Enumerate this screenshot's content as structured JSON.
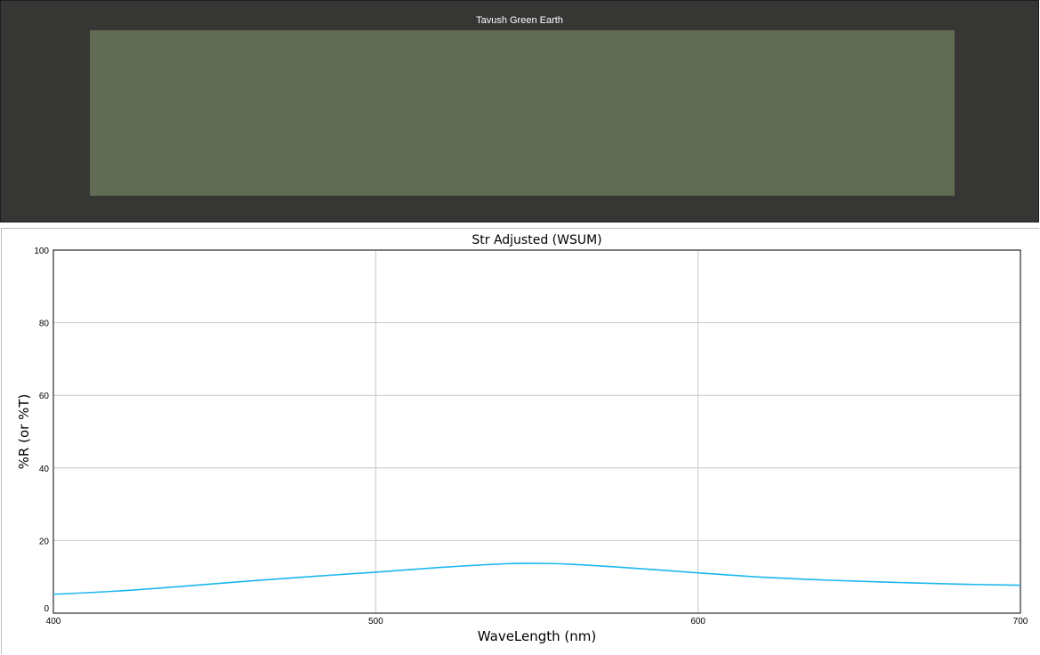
{
  "swatch": {
    "label": "Tavush Green Earth",
    "color": "#616a52",
    "background": "#363634"
  },
  "chart_data": {
    "type": "line",
    "title": "Str Adjusted (WSUM)",
    "xlabel": "WaveLength (nm)",
    "ylabel": "%R (or %T)",
    "xlim": [
      400,
      700
    ],
    "ylim": [
      0,
      100
    ],
    "xticks": [
      400,
      500,
      600,
      700
    ],
    "yticks": [
      0,
      20,
      40,
      60,
      80,
      100
    ],
    "grid": true,
    "line_color": "#1bb6ee",
    "series": [
      {
        "x": [
          400,
          420,
          440,
          460,
          480,
          500,
          520,
          540,
          550,
          560,
          580,
          600,
          620,
          640,
          660,
          680,
          700
        ],
        "values": [
          5.2,
          6.1,
          7.4,
          8.8,
          10.1,
          11.3,
          12.6,
          13.6,
          13.7,
          13.5,
          12.4,
          11.1,
          9.9,
          9.1,
          8.5,
          8.0,
          7.7
        ]
      }
    ]
  }
}
